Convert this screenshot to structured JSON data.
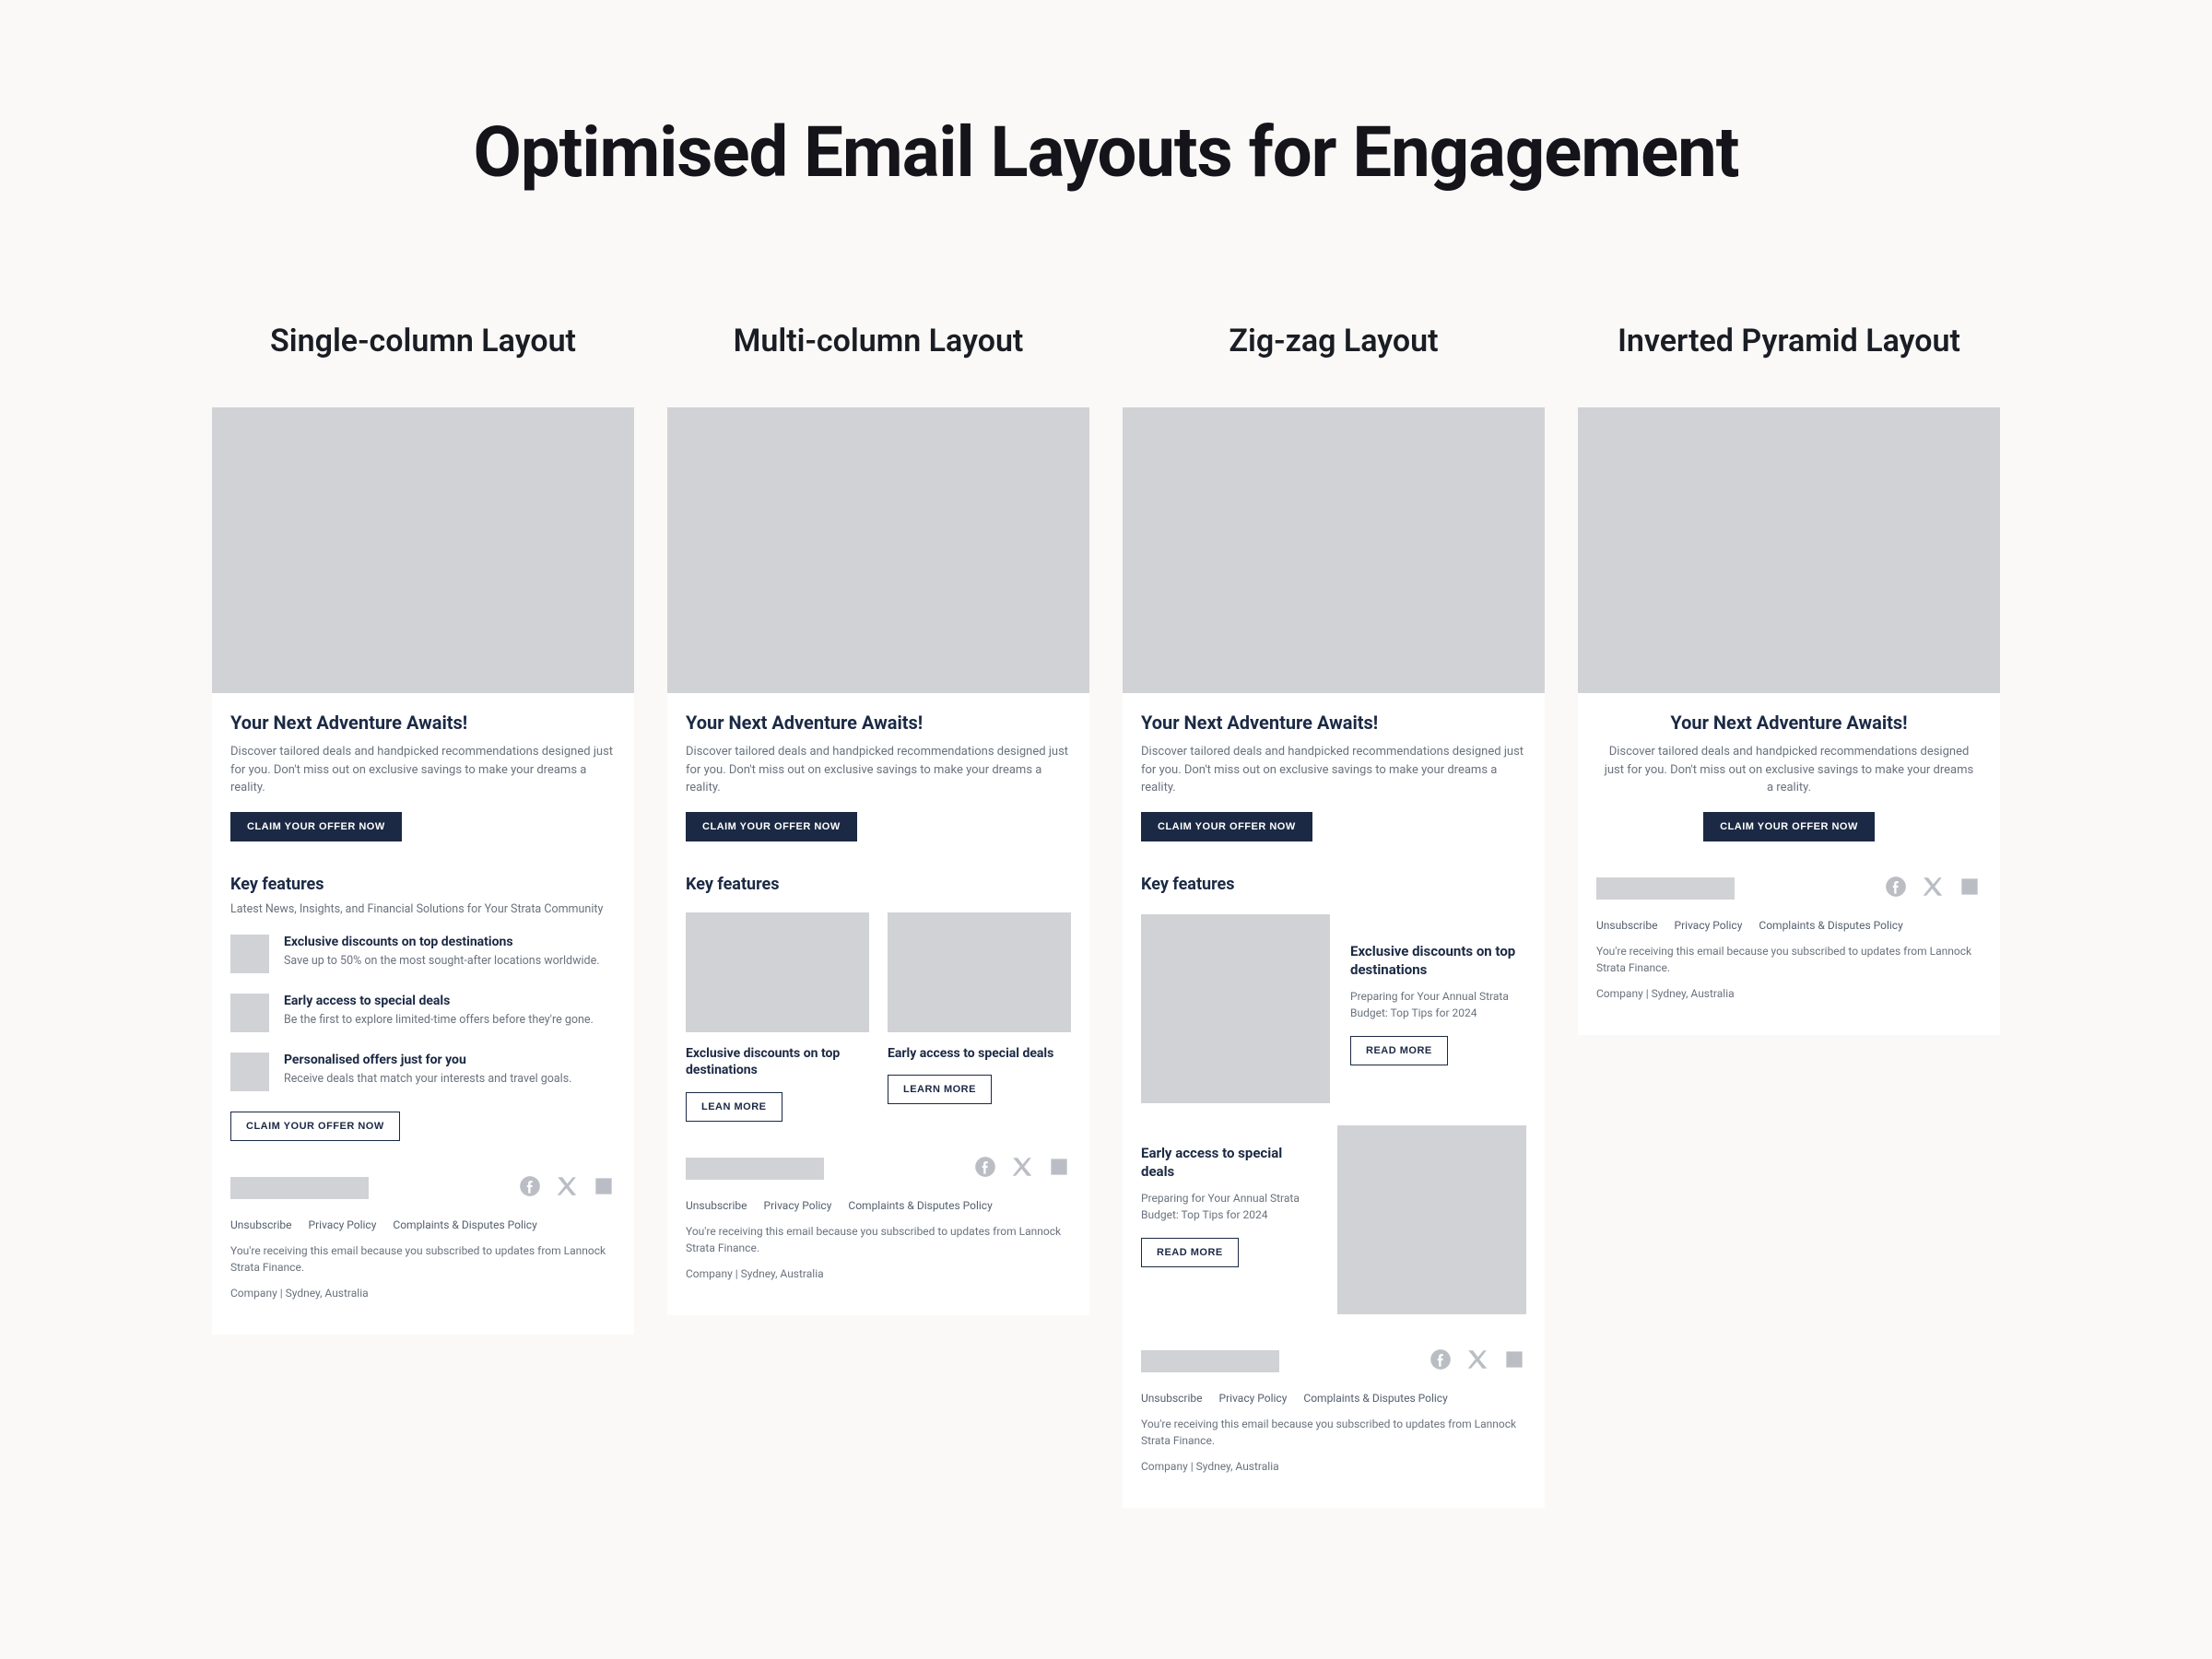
{
  "page_title": "Optimised Email Layouts for Engagement",
  "common": {
    "headline": "Your Next Adventure Awaits!",
    "body": "Discover tailored deals and handpicked recommendations designed just for you. Don't miss out on exclusive savings to make your dreams a reality.",
    "cta_primary": "CLAIM YOUR OFFER NOW",
    "key_features_heading": "Key features",
    "lean_more": "LEAN MORE",
    "learn_more": "LEARN MORE",
    "read_more": "READ MORE",
    "footer_links": {
      "unsubscribe": "Unsubscribe",
      "privacy": "Privacy Policy",
      "complaints": "Complaints & Disputes Policy"
    },
    "footer_reason": "You're receiving this email because you subscribed to updates from Lannock Strata Finance.",
    "footer_company": "Company | Sydney, Australia"
  },
  "layouts": {
    "single": {
      "title": "Single-column Layout",
      "features_sub": "Latest News, Insights, and Financial Solutions for Your Strata Community",
      "features": [
        {
          "title": "Exclusive discounts on top destinations",
          "desc": "Save up to 50% on the most sought-after locations worldwide."
        },
        {
          "title": "Early access to special deals",
          "desc": "Be the first to explore limited-time offers before they're gone."
        },
        {
          "title": "Personalised offers just for you",
          "desc": "Receive deals that match your interests and travel goals."
        }
      ]
    },
    "multi": {
      "title": "Multi-column Layout",
      "features": [
        {
          "title": "Exclusive discounts on top destinations"
        },
        {
          "title": "Early access to special deals"
        }
      ]
    },
    "zigzag": {
      "title": "Zig-zag Layout",
      "feature_desc": "Preparing for Your Annual Strata Budget: Top Tips for 2024",
      "features": [
        {
          "title": "Exclusive discounts on top destinations"
        },
        {
          "title": "Early access to special deals"
        }
      ]
    },
    "pyramid": {
      "title": "Inverted Pyramid Layout"
    }
  }
}
